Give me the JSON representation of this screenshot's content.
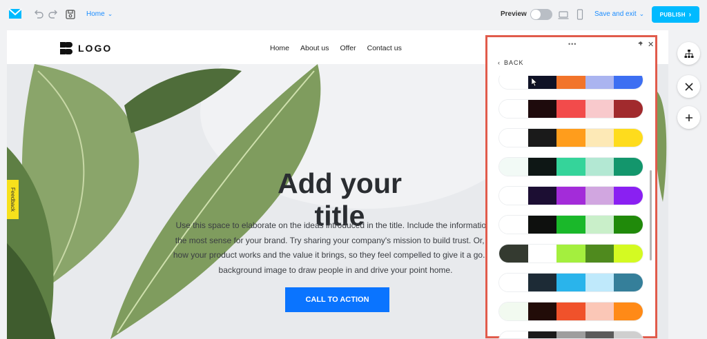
{
  "toolbar": {
    "page_name": "Home",
    "preview_label": "Preview",
    "save_label": "Save and exit",
    "publish_label": "PUBLISH"
  },
  "site": {
    "logo_text": "LOGO",
    "nav": [
      "Home",
      "About us",
      "Offer",
      "Contact us"
    ]
  },
  "hero": {
    "title": "Add your title",
    "body": [
      "Use this space to elaborate on the ideas introduced in the title. Include the information t",
      "the most sense for your brand. Try sharing your company's mission to build trust. Or, bri",
      "how your product works and the value it brings, so they feel compelled to give it a go. Cu",
      "background image to draw people in and drive your point home."
    ],
    "cta": "CALL TO ACTION"
  },
  "feedback_label": "Feedback",
  "panel": {
    "back_label": "BACK",
    "palettes": [
      [
        "#ffffff",
        "#0f1226",
        "#f2742a",
        "#aab4f0",
        "#3d6ff2"
      ],
      [
        "#ffffff",
        "#1e0a0c",
        "#f24b4b",
        "#f8c9cc",
        "#a12a2d"
      ],
      [
        "#ffffff",
        "#1a1a1a",
        "#ff9d1c",
        "#fde9b6",
        "#fedc1d"
      ],
      [
        "#f2faf6",
        "#0e1715",
        "#35d49a",
        "#b3e8d3",
        "#13966c"
      ],
      [
        "#ffffff",
        "#1c0e33",
        "#a32cd9",
        "#d1a6e0",
        "#8a20f2"
      ],
      [
        "#ffffff",
        "#0e100e",
        "#1ab82a",
        "#c9efc9",
        "#208a0a"
      ],
      [
        "#343a30",
        "#ffffff",
        "#a4ef3e",
        "#4f8a1e",
        "#d4fa22"
      ],
      [
        "#ffffff",
        "#1d2b36",
        "#2ab4eb",
        "#bfe9fb",
        "#357f9a"
      ],
      [
        "#f2faf0",
        "#220c08",
        "#f0522b",
        "#fbc7b7",
        "#ff8a17"
      ],
      [
        "#ffffff",
        "#1a1a1a",
        "#9e9e9e",
        "#5b5b5b",
        "#cfcfcf"
      ]
    ]
  },
  "colors": {
    "accent": "#1a8cff",
    "publish": "#00baff",
    "cta": "#0a74ff",
    "panel_border": "#e15b4b",
    "feedback": "#f7e11c"
  }
}
